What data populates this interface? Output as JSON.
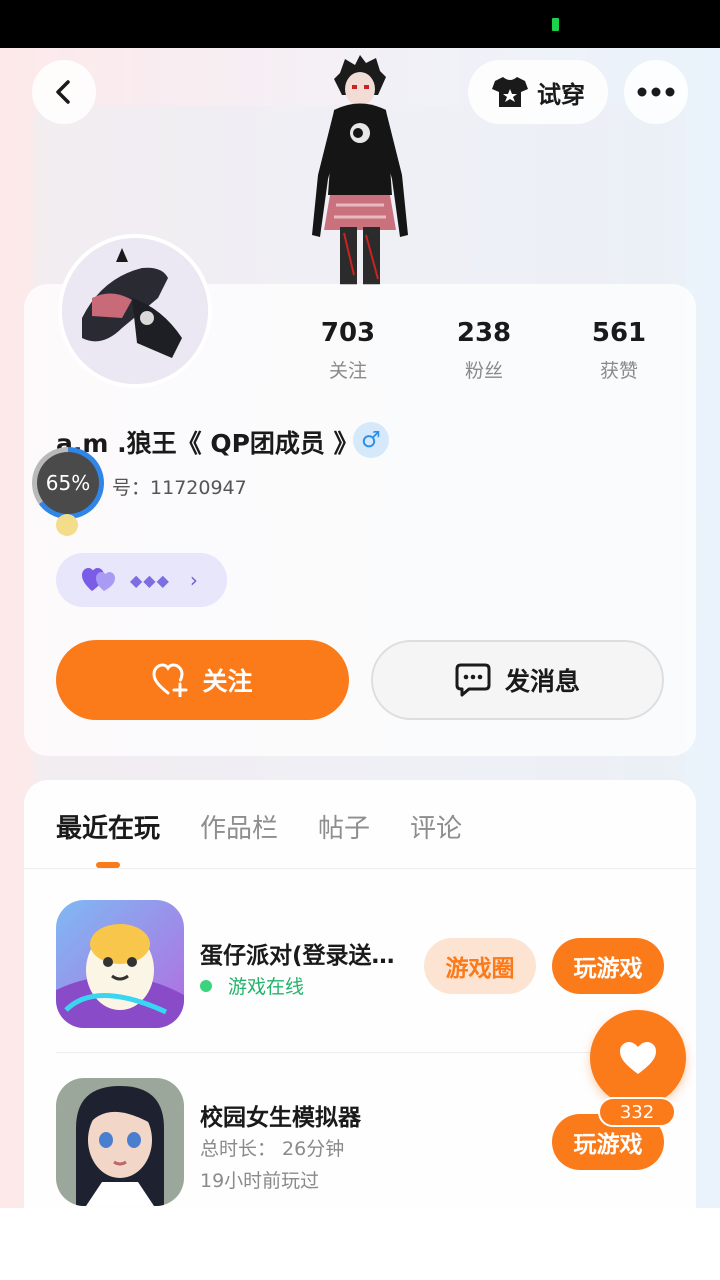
{
  "try_on": {
    "label": "试穿"
  },
  "stats": [
    {
      "value": "703",
      "label": "关注"
    },
    {
      "value": "238",
      "label": "粉丝"
    },
    {
      "value": "561",
      "label": "获赞"
    }
  ],
  "profile": {
    "username": "a.m .狼王《 QP团成员 》",
    "gender_symbol": "♂",
    "uid_label": "号：",
    "uid": "11720947",
    "level_progress": "65%",
    "level_progress_value": 0.65
  },
  "badge": {
    "dots": "◆◆◆",
    "chevron": "›"
  },
  "actions": {
    "follow": "关注",
    "message": "发消息"
  },
  "tabs": [
    "最近在玩",
    "作品栏",
    "帖子",
    "评论"
  ],
  "games": [
    {
      "title": "蛋仔派对(登录送…",
      "status": "游戏在线",
      "circle_label": "游戏圈",
      "play_label": "玩游戏"
    },
    {
      "title": "校园女生模拟器",
      "duration": "总时长：  26分钟",
      "last_played": "19小时前玩过",
      "play_label": "玩游戏"
    }
  ],
  "fab": {
    "count": "332"
  },
  "colors": {
    "accent": "#fb7a1a",
    "online": "#23b36a",
    "gender": "#2d8fe6"
  }
}
